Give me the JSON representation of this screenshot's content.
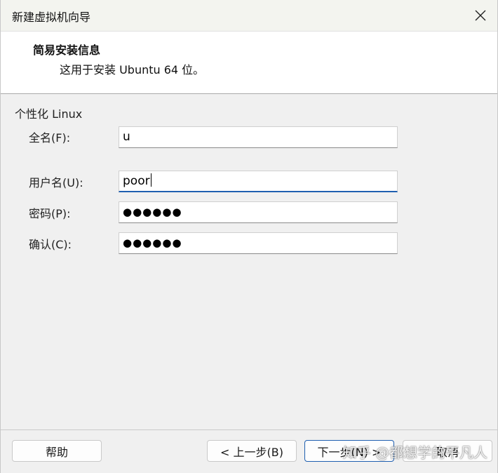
{
  "window": {
    "title": "新建虚拟机向导"
  },
  "header": {
    "title": "简易安装信息",
    "subtitle": "这用于安装 Ubuntu 64 位。"
  },
  "personalize": {
    "group_label": "个性化 Linux",
    "fields": [
      {
        "label": "全名(F):",
        "value": "u",
        "type": "text"
      },
      {
        "label": "用户名(U):",
        "value": "poor",
        "type": "text",
        "focused": true
      },
      {
        "label": "密码(P):",
        "value": "●●●●●●",
        "type": "password"
      },
      {
        "label": "确认(C):",
        "value": "●●●●●●",
        "type": "password"
      }
    ]
  },
  "footer": {
    "help_label": "帮助",
    "back_label": "< 上一步(B)",
    "next_label": "下一步(N) >",
    "cancel_label": "取消"
  },
  "watermark": "知乎 @都想学的平凡人",
  "colors": {
    "focus_accent": "#1f5fb0",
    "dialog_bg": "#f0f0f0",
    "header_bg": "#ffffff"
  },
  "icons": {
    "close": "close-icon"
  }
}
